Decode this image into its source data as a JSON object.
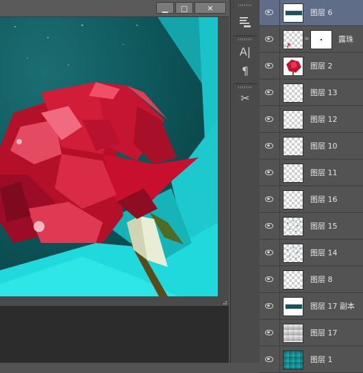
{
  "window": {
    "controls": {
      "minimize": "▁",
      "maximize": "□",
      "close": "✕"
    }
  },
  "canvas": {
    "image_description_colors": {
      "background": "#0f5a5e",
      "highlight_cyan": "#1fd8dc",
      "rose_red": "#c8102e",
      "bud_white": "#e9ecd2",
      "leaf_green": "#4e6b24"
    }
  },
  "tools": [
    {
      "icon": "paragraph-style-icon"
    },
    {
      "icon": "character-text-icon",
      "glyph": "A|"
    },
    {
      "icon": "paragraph-mark-icon",
      "glyph": "¶"
    },
    {
      "icon": "scissors-tool-icon",
      "glyph": "✂"
    }
  ],
  "layers": [
    {
      "name": "图层 6",
      "thumb": "strip",
      "selected": true
    },
    {
      "name": "露珠",
      "thumb": "mask",
      "selected": false
    },
    {
      "name": "图层 2",
      "thumb": "rose",
      "selected": false
    },
    {
      "name": "图层 13",
      "thumb": "transparent",
      "selected": false
    },
    {
      "name": "图层 12",
      "thumb": "transparent",
      "selected": false
    },
    {
      "name": "图层 10",
      "thumb": "transparent",
      "selected": false
    },
    {
      "name": "图层 11",
      "thumb": "transparent",
      "selected": false
    },
    {
      "name": "图层 16",
      "thumb": "transparent",
      "selected": false
    },
    {
      "name": "图层 15",
      "thumb": "dots",
      "selected": false
    },
    {
      "name": "图层 14",
      "thumb": "dots",
      "selected": false
    },
    {
      "name": "图层 8",
      "thumb": "transparent",
      "selected": false
    },
    {
      "name": "图层 17 副本",
      "thumb": "strip",
      "selected": false
    },
    {
      "name": "图层 17",
      "thumb": "gray",
      "selected": false
    },
    {
      "name": "图层 1",
      "thumb": "teal",
      "selected": false
    }
  ]
}
